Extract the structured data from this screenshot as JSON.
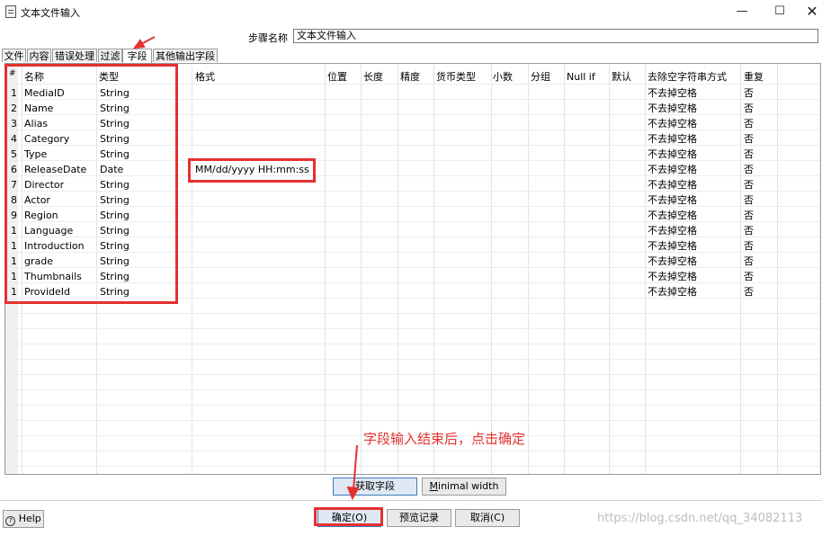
{
  "window": {
    "title": "文本文件输入",
    "min_glyph": "—",
    "max_glyph": "☐",
    "close_glyph": "✕"
  },
  "step": {
    "label": "步骤名称",
    "value": "文本文件输入"
  },
  "tabs": [
    {
      "label": "文件"
    },
    {
      "label": "内容"
    },
    {
      "label": "错误处理"
    },
    {
      "label": "过滤"
    },
    {
      "label": "字段",
      "active": true
    },
    {
      "label": "其他输出字段"
    }
  ],
  "table": {
    "columns": [
      "#",
      "名称",
      "类型",
      "格式",
      "位置",
      "长度",
      "精度",
      "货币类型",
      "小数",
      "分组",
      "Null if",
      "默认",
      "去除空字符串方式",
      "重复"
    ],
    "rows": [
      {
        "n": "1",
        "name": "MediaID",
        "type": "String",
        "format": "",
        "trim": "不去掉空格",
        "repeat": "否"
      },
      {
        "n": "2",
        "name": "Name",
        "type": "String",
        "format": "",
        "trim": "不去掉空格",
        "repeat": "否"
      },
      {
        "n": "3",
        "name": "Alias",
        "type": "String",
        "format": "",
        "trim": "不去掉空格",
        "repeat": "否"
      },
      {
        "n": "4",
        "name": "Category",
        "type": "String",
        "format": "",
        "trim": "不去掉空格",
        "repeat": "否"
      },
      {
        "n": "5",
        "name": "Type",
        "type": "String",
        "format": "",
        "trim": "不去掉空格",
        "repeat": "否"
      },
      {
        "n": "6",
        "name": "ReleaseDate",
        "type": "Date",
        "format": "MM/dd/yyyy HH:mm:ss",
        "trim": "不去掉空格",
        "repeat": "否"
      },
      {
        "n": "7",
        "name": "Director",
        "type": "String",
        "format": "",
        "trim": "不去掉空格",
        "repeat": "否"
      },
      {
        "n": "8",
        "name": "Actor",
        "type": "String",
        "format": "",
        "trim": "不去掉空格",
        "repeat": "否"
      },
      {
        "n": "9",
        "name": "Region",
        "type": "String",
        "format": "",
        "trim": "不去掉空格",
        "repeat": "否"
      },
      {
        "n": "1",
        "name": "Language",
        "type": "String",
        "format": "",
        "trim": "不去掉空格",
        "repeat": "否"
      },
      {
        "n": "1",
        "name": "Introduction",
        "type": "String",
        "format": "",
        "trim": "不去掉空格",
        "repeat": "否"
      },
      {
        "n": "1",
        "name": "grade",
        "type": "String",
        "format": "",
        "trim": "不去掉空格",
        "repeat": "否"
      },
      {
        "n": "1",
        "name": "Thumbnails",
        "type": "String",
        "format": "",
        "trim": "不去掉空格",
        "repeat": "否"
      },
      {
        "n": "1",
        "name": "ProvideId",
        "type": "String",
        "format": "",
        "trim": "不去掉空格",
        "repeat": "否"
      }
    ]
  },
  "buttons": {
    "get_fields": "获取字段",
    "minimal_width": "Minimal width",
    "help": "Help",
    "ok": "确定(O)",
    "preview": "预览记录",
    "cancel": "取消(C)"
  },
  "annotation": "字段输入结束后，点击确定",
  "watermark": "https://blog.csdn.net/qq_34082113",
  "colors": {
    "annotation_red": "#e53030",
    "focus_blue": "#3d7ab8"
  }
}
